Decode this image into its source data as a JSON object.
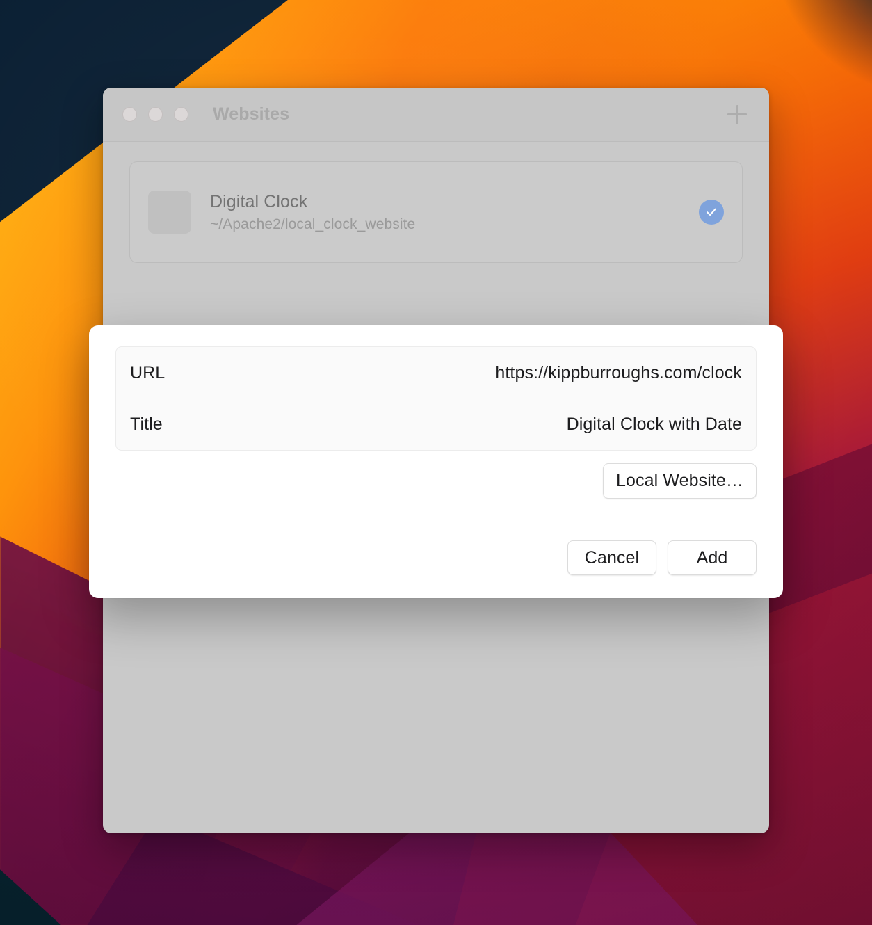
{
  "window": {
    "title": "Websites",
    "traffic_lights": [
      "close",
      "minimize",
      "zoom"
    ],
    "add_button_icon": "plus-icon",
    "site_list": [
      {
        "name": "Digital Clock",
        "path": "~/Apache2/local_clock_website",
        "selected": true,
        "badge_icon": "check-icon",
        "badge_color": "#7fa3dc"
      }
    ]
  },
  "dialog": {
    "fields": [
      {
        "label": "URL",
        "value": "https://kippburroughs.com/clock"
      },
      {
        "label": "Title",
        "value": "Digital Clock with Date"
      }
    ],
    "local_website_button": "Local Website…",
    "cancel_button": "Cancel",
    "add_button": "Add"
  },
  "colors": {
    "accent_badge": "#7fa3dc",
    "window_chrome": "#c9c9c9",
    "dialog_background": "#ffffff",
    "field_background": "#fafafa"
  }
}
